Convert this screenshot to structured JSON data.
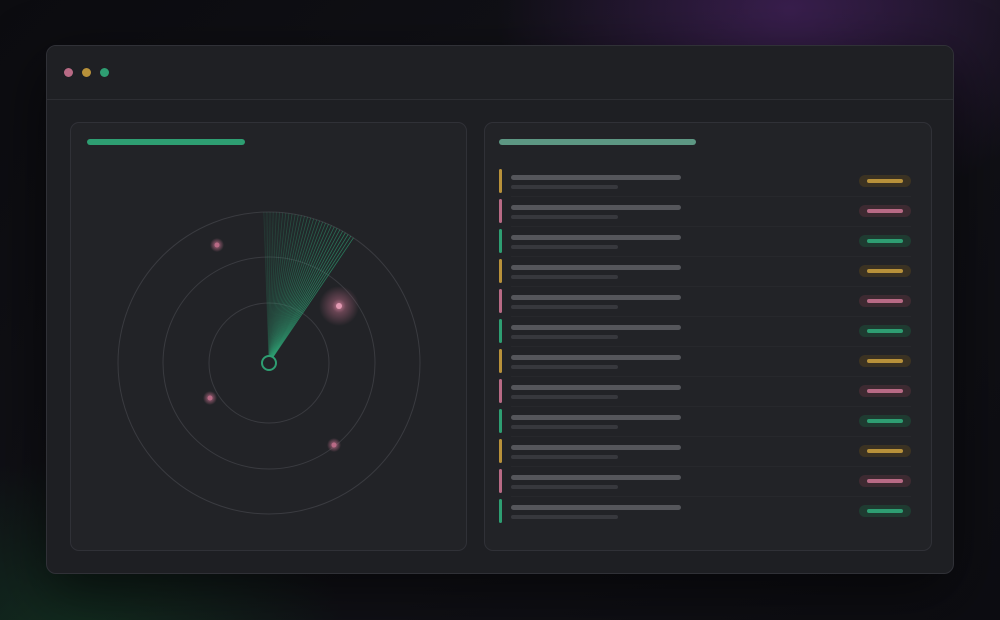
{
  "colors": {
    "green": "#2e9e72",
    "teal": "#2f8f78",
    "gold": "#b8913a",
    "pink": "#b86a85",
    "green_pill_bg": "#1f3b31",
    "gold_pill_bg": "#3b3222",
    "pink_pill_bg": "#3d2a31"
  },
  "window": {
    "controls": [
      "close-dot",
      "minimize-dot",
      "zoom-dot"
    ]
  },
  "radar": {
    "blips": 4,
    "highlighted_blip": 1
  },
  "list": {
    "rows": [
      {
        "status": "gold"
      },
      {
        "status": "pink"
      },
      {
        "status": "green"
      },
      {
        "status": "gold"
      },
      {
        "status": "pink"
      },
      {
        "status": "green"
      },
      {
        "status": "gold"
      },
      {
        "status": "pink"
      },
      {
        "status": "green"
      },
      {
        "status": "gold"
      },
      {
        "status": "pink"
      },
      {
        "status": "green"
      }
    ]
  }
}
